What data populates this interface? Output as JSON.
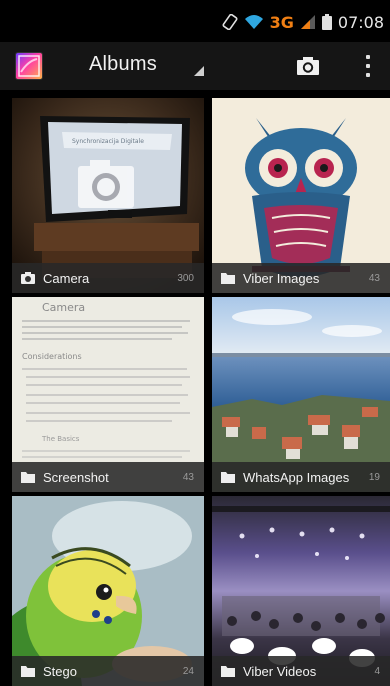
{
  "status_bar": {
    "network_type": "3G",
    "time": "07:08"
  },
  "action_bar": {
    "title": "Albums"
  },
  "albums": [
    {
      "name": "Camera",
      "count": "300",
      "folder_icon": "camera-icon"
    },
    {
      "name": "Viber Images",
      "count": "43",
      "folder_icon": "folder-icon"
    },
    {
      "name": "Screenshot",
      "count": "43",
      "folder_icon": "folder-icon"
    },
    {
      "name": "WhatsApp Images",
      "count": "19",
      "folder_icon": "folder-icon"
    },
    {
      "name": "Stego",
      "count": "24",
      "folder_icon": "folder-icon"
    },
    {
      "name": "Viber Videos",
      "count": "4",
      "folder_icon": "folder-icon"
    }
  ],
  "colors": {
    "network_accent": "#f07f14",
    "caption_bg": "#282828",
    "actionbar_bg": "#151515"
  }
}
